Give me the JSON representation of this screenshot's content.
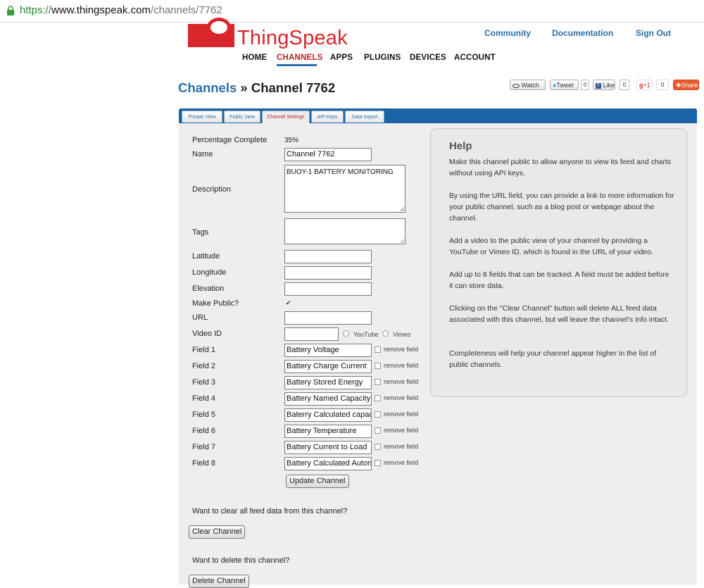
{
  "browser": {
    "url_proto": "https://",
    "url_host": "www.thingspeak.com",
    "url_path": "/channels/7762"
  },
  "header": {
    "logo_text": "ThingSpeak",
    "top_links": [
      "Community",
      "Documentation",
      "Sign Out"
    ],
    "nav": [
      "HOME",
      "CHANNELS",
      "APPS",
      "PLUGINS",
      "DEVICES",
      "ACCOUNT"
    ],
    "active_nav": "CHANNELS"
  },
  "title": {
    "link": "Channels",
    "separator": " » ",
    "current": "Channel 7762"
  },
  "social": {
    "watch": "Watch",
    "tweet": "Tweet",
    "tweet_count": "0",
    "like": "Like",
    "like_count": "0",
    "gplus": "+1",
    "gplus_count": "0",
    "share": "Share"
  },
  "tabs": [
    "Private View",
    "Public View",
    "Channel Settings",
    "API Keys",
    "Data Import"
  ],
  "active_tab": "Channel Settings",
  "form": {
    "percentage_label": "Percentage Complete",
    "percentage_value": "35%",
    "name_label": "Name",
    "name_value": "Channel 7762",
    "description_label": "Description",
    "description_value": "BUOY-1 BATTERY MONITORING",
    "tags_label": "Tags",
    "tags_value": "",
    "latitude_label": "Latitude",
    "longitude_label": "Longitude",
    "elevation_label": "Elevation",
    "make_public_label": "Make Public?",
    "make_public_checked": true,
    "url_label": "URL",
    "video_label": "Video ID",
    "youtube_label": "YouTube",
    "vimeo_label": "Vimeo",
    "remove_field_label": "remove field",
    "fields": [
      {
        "label": "Field 1",
        "value": "Battery Voltage"
      },
      {
        "label": "Field 2",
        "value": "Battery Charge Current"
      },
      {
        "label": "Field 3",
        "value": "Battery Stored Energy"
      },
      {
        "label": "Field 4",
        "value": "Battery Named Capacity"
      },
      {
        "label": "Field 5",
        "value": "Baterry Calculated capacity"
      },
      {
        "label": "Field 6",
        "value": "Battery Temperature"
      },
      {
        "label": "Field 7",
        "value": "Battery Current to Load"
      },
      {
        "label": "Field 8",
        "value": "Battery Calculated Autonomy"
      }
    ],
    "update_button": "Update Channel",
    "clear_question": "Want to clear all feed data from this channel?",
    "clear_button": "Clear Channel",
    "delete_question": "Want to delete this channel?",
    "delete_button": "Delete Channel"
  },
  "help": {
    "title": "Help",
    "paragraphs": [
      "Make this channel public to allow anyone to view its feed and charts without using API keys.",
      "By using the URL field, you can provide a link to more information for your public channel, such as a blog post or webpage about the channel.",
      "Add a video to the public view of your channel by providing a YouTube or Vimeo ID, which is found in the URL of your video.",
      "Add up to 8 fields that can be tracked. A field must be added before it can store data.",
      "Clicking on the \"Clear Channel\" button will delete ALL feed data associated with this channel, but will leave the channel's info intact.",
      "Completeness will help your channel appear higher in the list of public channels."
    ]
  },
  "colors": {
    "brand_red": "#d8262b",
    "link_blue": "#2b6ea7",
    "tab_bar_blue": "#1a64a5",
    "panel_gray": "#eeeeee"
  }
}
